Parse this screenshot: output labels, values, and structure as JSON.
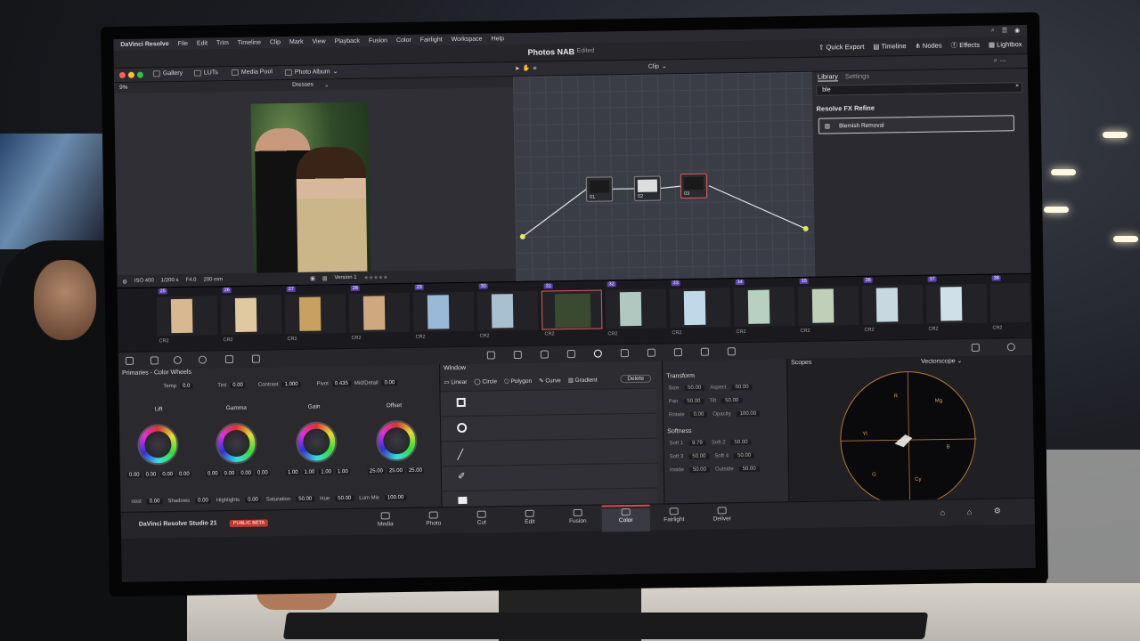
{
  "menubar": {
    "brand": "DaVinci Resolve",
    "items": [
      "File",
      "Edit",
      "Trim",
      "Timeline",
      "Clip",
      "Mark",
      "View",
      "Playback",
      "Fusion",
      "Color",
      "Fairlight",
      "Workspace",
      "Help"
    ]
  },
  "topbar": {
    "project": "Photos NAB",
    "status": "Edited",
    "quick_export": "Quick Export",
    "timeline": "Timeline",
    "nodes": "Nodes",
    "effects": "Effects",
    "lightbox": "Lightbox"
  },
  "toolbar": {
    "gallery": "Gallery",
    "luts": "LUTs",
    "media_pool": "Media Pool",
    "photo_album": "Photo Album",
    "zoom": "9%",
    "album_name": "Dresses",
    "clip_mode": "Clip"
  },
  "viewer": {
    "iso": "ISO 400",
    "shutter": "1/200 s",
    "aperture": "F4.0",
    "focal": "200 mm",
    "version": "Version 1",
    "rating": "★★★★★"
  },
  "nodes": [
    {
      "label": "01"
    },
    {
      "label": "02"
    },
    {
      "label": "03"
    }
  ],
  "library": {
    "tab_library": "Library",
    "tab_settings": "Settings",
    "search_value": "ble",
    "section": "Resolve FX Refine",
    "item": "Blemish Removal"
  },
  "strip": {
    "clips": [
      {
        "num": "25",
        "cr": "CR2"
      },
      {
        "num": "26",
        "cr": "CR2"
      },
      {
        "num": "27",
        "cr": "CR2"
      },
      {
        "num": "28",
        "cr": "CR2"
      },
      {
        "num": "29",
        "cr": "CR2"
      },
      {
        "num": "30",
        "cr": "CR2"
      },
      {
        "num": "31",
        "cr": "CR2"
      },
      {
        "num": "32",
        "cr": "CR2"
      },
      {
        "num": "33",
        "cr": "CR2"
      },
      {
        "num": "34",
        "cr": "CR2"
      },
      {
        "num": "35",
        "cr": "CR2"
      },
      {
        "num": "36",
        "cr": "CR2"
      },
      {
        "num": "37",
        "cr": "CR2"
      },
      {
        "num": "38",
        "cr": "CR2"
      }
    ]
  },
  "primaries": {
    "title": "Primaries - Color Wheels",
    "temp_label": "Temp",
    "temp": "0.0",
    "tint_label": "Tint",
    "tint": "0.00",
    "contrast_label": "Contrast",
    "contrast": "1.000",
    "pivot_label": "Pivot",
    "pivot": "0.435",
    "middetail_label": "Mid/Detail",
    "middetail": "0.00",
    "wheels": [
      {
        "name": "Lift",
        "vals": [
          "0.00",
          "0.00",
          "0.00",
          "0.00"
        ]
      },
      {
        "name": "Gamma",
        "vals": [
          "0.00",
          "0.00",
          "0.00",
          "0.00"
        ]
      },
      {
        "name": "Gain",
        "vals": [
          "1.00",
          "1.00",
          "1.00",
          "1.00"
        ]
      },
      {
        "name": "Offset",
        "vals": [
          "25.00",
          "25.00",
          "25.00"
        ]
      }
    ],
    "boost_label": "oost",
    "boost": "0.00",
    "shadows_label": "Shadows",
    "shadows": "0.00",
    "highlights_label": "Highlights",
    "highlights": "0.00",
    "saturation_label": "Saturation",
    "saturation": "50.00",
    "hue_label": "Hue",
    "hue": "50.00",
    "lummix_label": "Lum Mix",
    "lummix": "100.00"
  },
  "window": {
    "title": "Window",
    "linear": "Linear",
    "circle": "Circle",
    "polygon": "Polygon",
    "curve": "Curve",
    "gradient": "Gradient",
    "delete": "Delete"
  },
  "transform": {
    "title": "Transform",
    "size_label": "Size",
    "size": "50.00",
    "aspect_label": "Aspect",
    "aspect": "50.00",
    "pan_label": "Pan",
    "pan": "50.00",
    "tilt_label": "Tilt",
    "tilt": "50.00",
    "rotate_label": "Rotate",
    "rotate": "0.00",
    "opacity_label": "Opacity",
    "opacity": "100.00",
    "softness_title": "Softness",
    "soft1_label": "Soft 1",
    "soft1": "9.79",
    "soft2_label": "Soft 2",
    "soft2": "50.00",
    "soft3_label": "Soft 3",
    "soft3": "50.00",
    "soft4_label": "Soft 4",
    "soft4": "50.00",
    "inside_label": "Inside",
    "inside": "50.00",
    "outside_label": "Outside",
    "outside": "50.00"
  },
  "scopes": {
    "title": "Scopes",
    "mode": "Vectorscope",
    "markers": [
      "R",
      "Yl",
      "G",
      "Cy",
      "B",
      "Mg"
    ]
  },
  "pages": {
    "app_name": "DaVinci Resolve Studio 21",
    "beta": "PUBLIC BETA",
    "items": [
      "Media",
      "Photo",
      "Cut",
      "Edit",
      "Fusion",
      "Color",
      "Fairlight",
      "Deliver"
    ],
    "active": "Color"
  },
  "colors": {
    "accent_red": "#e0455a",
    "clip_num_purple": "#5a3fb0",
    "scope_orange": "#b07a3a"
  }
}
